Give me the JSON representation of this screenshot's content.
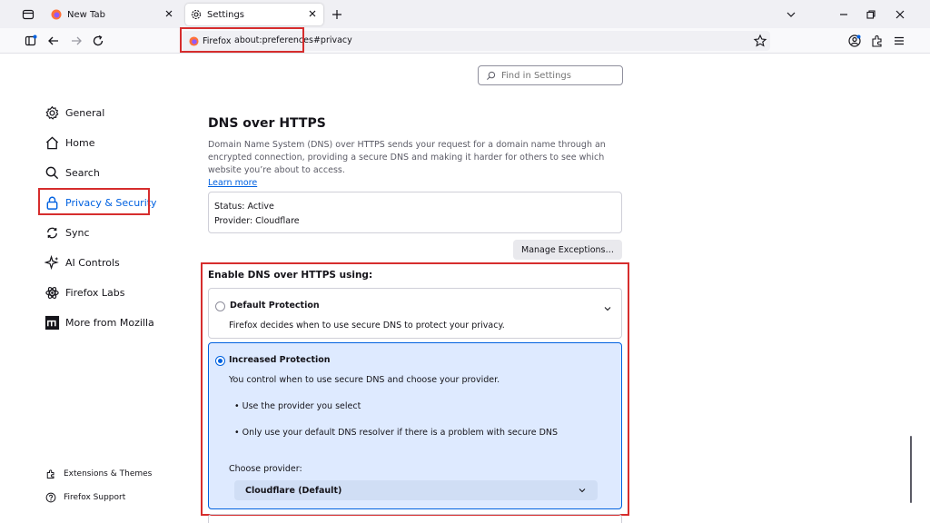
{
  "browser": {
    "tabs": [
      {
        "label": "New Tab",
        "icon": "firefox-icon",
        "active": false
      },
      {
        "label": "Settings",
        "icon": "gear-icon",
        "active": true
      }
    ],
    "url_identity": "Firefox",
    "url": "about:preferences#privacy"
  },
  "search": {
    "placeholder": "Find in Settings"
  },
  "sidebar": {
    "items": [
      {
        "label": "General",
        "icon": "gear-icon"
      },
      {
        "label": "Home",
        "icon": "home-icon"
      },
      {
        "label": "Search",
        "icon": "search-icon"
      },
      {
        "label": "Privacy & Security",
        "icon": "lock-icon",
        "selected": true
      },
      {
        "label": "Sync",
        "icon": "sync-icon"
      },
      {
        "label": "AI Controls",
        "icon": "sparkle-icon"
      },
      {
        "label": "Firefox Labs",
        "icon": "labs-icon"
      },
      {
        "label": "More from Mozilla",
        "icon": "mozilla-icon"
      }
    ],
    "footer": [
      {
        "label": "Extensions & Themes",
        "icon": "puzzle-icon"
      },
      {
        "label": "Firefox Support",
        "icon": "help-icon"
      }
    ]
  },
  "dns": {
    "title": "DNS over HTTPS",
    "description": "Domain Name System (DNS) over HTTPS sends your request for a domain name through an encrypted connection, providing a secure DNS and making it harder for others to see which website you’re about to access.",
    "learn_more": "Learn more",
    "status": "Status: Active",
    "provider": "Provider: Cloudflare",
    "manage_exceptions": "Manage Exceptions…",
    "enable_title": "Enable DNS over HTTPS using:",
    "options": {
      "default": {
        "label": "Default Protection",
        "description": "Firefox decides when to use secure DNS to protect your privacy.",
        "checked": false
      },
      "increased": {
        "label": "Increased Protection",
        "description": "You control when to use secure DNS and choose your provider.",
        "bullets": [
          "Use the provider you select",
          "Only use your default DNS resolver if there is a problem with secure DNS"
        ],
        "choose_provider_label": "Choose provider:",
        "selected_provider": "Cloudflare (Default)",
        "checked": true
      }
    }
  },
  "colors": {
    "accent": "#0061e0",
    "highlight_box": "#d62d2d",
    "selected_card_bg": "#deeaff"
  }
}
